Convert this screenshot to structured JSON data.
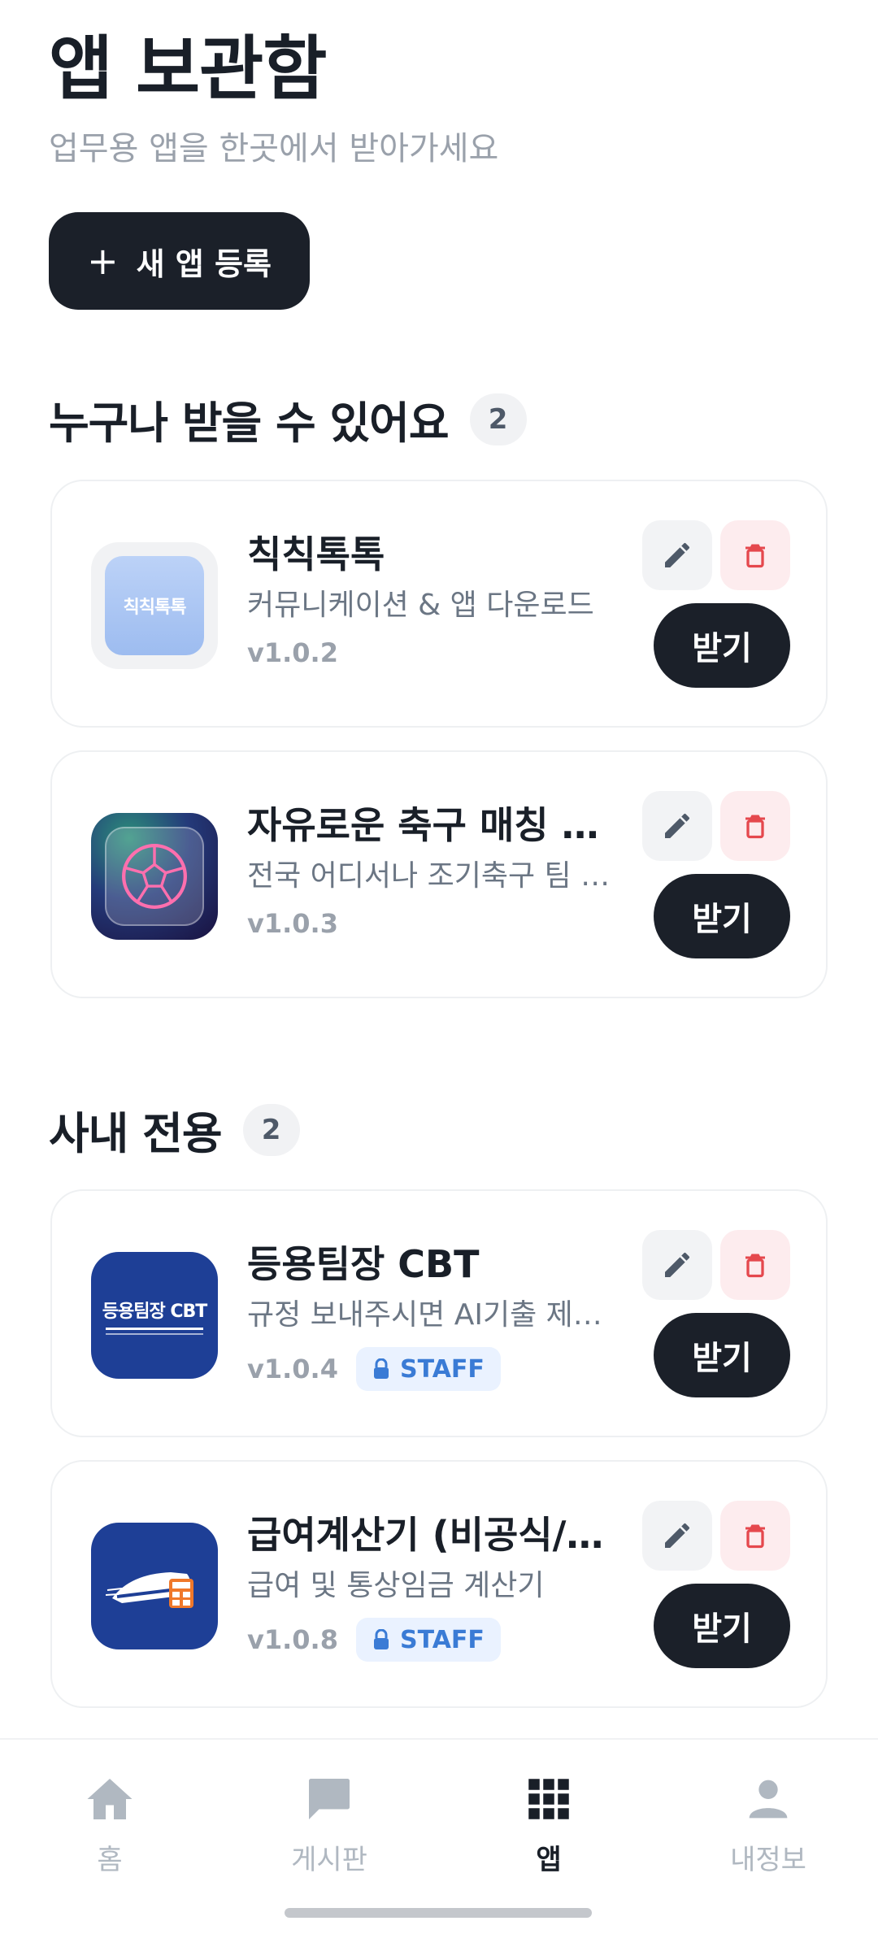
{
  "header": {
    "title": "앱 보관함",
    "subtitle": "업무용 앱을 한곳에서 받아가세요",
    "add_button_icon": "plus-icon",
    "add_button_label": "새 앱 등록"
  },
  "sections": [
    {
      "title": "누구나 받을 수 있어요",
      "count": "2",
      "apps": [
        {
          "name": "칙칙톡톡",
          "description": "커뮤니케이션 & 앱 다운로드",
          "version": "v1.0.2",
          "icon_text": "칙칙톡톡",
          "get_label": "받기"
        },
        {
          "name": "자유로운 축구 매칭 플랫폼",
          "description": "전국 어디서나 조기축구 팀 매칭",
          "version": "v1.0.3",
          "icon_name": "soccer-ball-icon",
          "get_label": "받기"
        }
      ]
    },
    {
      "title": "사내 전용",
      "count": "2",
      "apps": [
        {
          "name": "등용팀장 CBT",
          "description": "규정 보내주시면 AI기출 제작해드립니다",
          "version": "v1.0.4",
          "icon_text": "등용팀장 CBT",
          "badge": "STAFF",
          "get_label": "받기"
        },
        {
          "name": "급여계산기 (비공식/안내용)",
          "description": "급여 및 통상임금 계산기",
          "version": "v1.0.8",
          "icon_name": "train-calculator-icon",
          "badge": "STAFF",
          "get_label": "받기"
        }
      ]
    }
  ],
  "bottom_nav": [
    {
      "label": "홈",
      "icon": "home-icon",
      "active": false
    },
    {
      "label": "게시판",
      "icon": "chat-bubble-icon",
      "active": false
    },
    {
      "label": "앱",
      "icon": "apps-grid-icon",
      "active": true
    },
    {
      "label": "내정보",
      "icon": "person-icon",
      "active": false
    }
  ],
  "colors": {
    "primary_dark": "#1b2029",
    "muted_text": "#9aa1ab",
    "delete_red": "#e5484d",
    "staff_blue": "#3a7bd5"
  }
}
